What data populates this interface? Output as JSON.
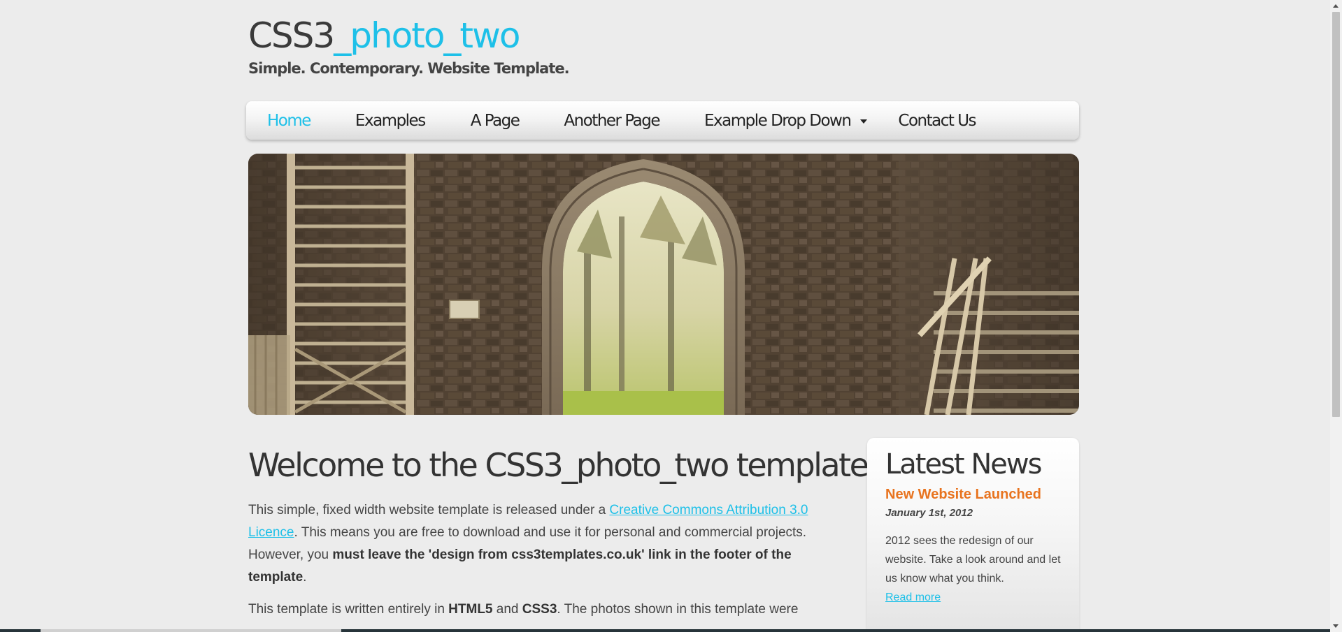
{
  "header": {
    "logo_part1": "CSS3",
    "logo_part2": "_photo_two",
    "slogan": "Simple. Contemporary. Website Template."
  },
  "menu": {
    "items": [
      {
        "label": "Home",
        "selected": true
      },
      {
        "label": "Examples",
        "selected": false
      },
      {
        "label": "A Page",
        "selected": false
      },
      {
        "label": "Another Page",
        "selected": false
      },
      {
        "label": "Example Drop Down",
        "selected": false,
        "has_dropdown": true
      },
      {
        "label": "Contact Us",
        "selected": false
      }
    ]
  },
  "content": {
    "heading": "Welcome to the CSS3_photo_two template",
    "para1": {
      "t1": "This simple, fixed width website template is released under a ",
      "link": "Creative Commons Attribution 3.0 Licence",
      "t2": ". This means you are free to download and use it for personal and commercial projects. However, you ",
      "bold": "must leave the 'design from css3templates.co.uk' link in the footer of the template",
      "t3": "."
    },
    "para2": {
      "t1": "This template is written entirely in ",
      "b1": "HTML5",
      "t2": " and ",
      "b2": "CSS3",
      "t3": ". The photos shown in this template were"
    }
  },
  "sidebar": {
    "heading": "Latest News",
    "news_title": "New Website Launched",
    "news_date": "January 1st, 2012",
    "news_body": "2012 sees the redesign of our website. Take a look around and let us know what you think.",
    "read_more": "Read more"
  },
  "colors": {
    "accent": "#1ec0e8",
    "news_title": "#e8731e",
    "background": "#ececec"
  }
}
